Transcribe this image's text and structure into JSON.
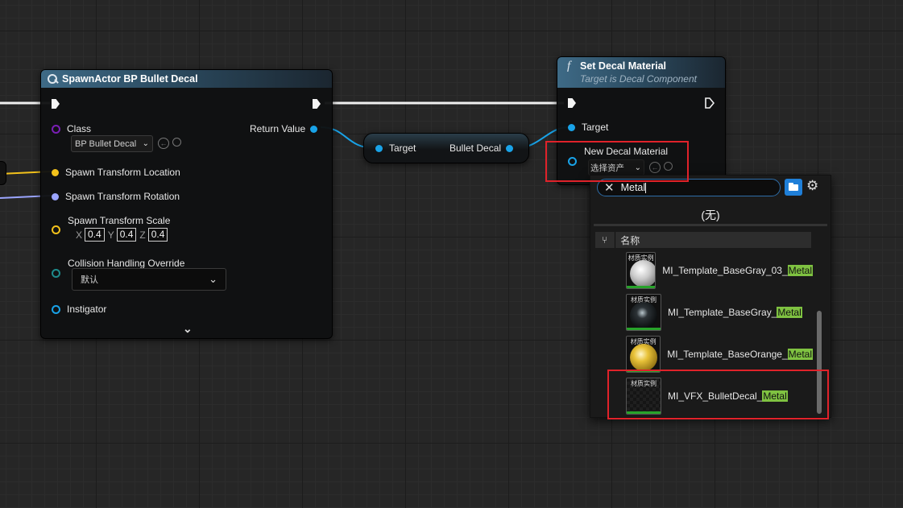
{
  "spawn_node": {
    "title": "SpawnActor BP Bullet Decal",
    "class_label": "Class",
    "class_value": "BP Bullet Decal",
    "return_label": "Return Value",
    "location_label": "Spawn Transform Location",
    "rotation_label": "Spawn Transform Rotation",
    "scale_label": "Spawn Transform Scale",
    "scale_x_letter": "X",
    "scale_x": "0.4",
    "scale_y_letter": "Y",
    "scale_y": "0.4",
    "scale_z_letter": "Z",
    "scale_z": "0.4",
    "collision_label": "Collision Handling Override",
    "collision_value": "默认",
    "instigator_label": "Instigator"
  },
  "reroute_node": {
    "target_label": "Target",
    "output_label": "Bullet Decal"
  },
  "set_decal_node": {
    "function_glyph": "f",
    "title": "Set Decal Material",
    "subtitle": "Target is Decal Component",
    "target_label": "Target",
    "material_label": "New Decal Material",
    "material_dropdown": "选择资产"
  },
  "asset_picker": {
    "search_value": "Metal",
    "none_label": "(无)",
    "column_header": "名称",
    "thumb_caption": "材质实例",
    "assets": [
      {
        "prefix": "MI_Template_BaseGray_03_",
        "match": "Metal"
      },
      {
        "prefix": "MI_Template_BaseGray_",
        "match": "Metal"
      },
      {
        "prefix": "MI_Template_BaseOrange_",
        "match": "Metal"
      },
      {
        "prefix": "MI_VFX_BulletDecal_",
        "match": "Metal"
      }
    ]
  },
  "colors": {
    "exec_wire": "#f0f0f0",
    "object_pin": "#19a3e8",
    "class_pin": "#7a1fb5",
    "vector_pin": "#f3c21b",
    "rotator_pin": "#9ba5ff",
    "struct_pin": "#1e8b8b",
    "highlight_red": "#e0222a",
    "search_match": "#7fc241"
  }
}
